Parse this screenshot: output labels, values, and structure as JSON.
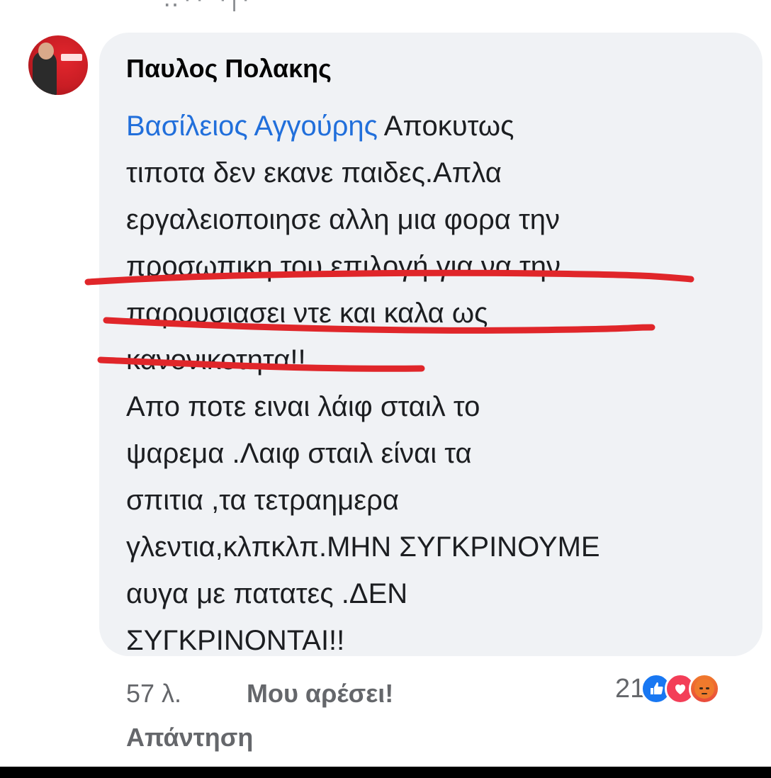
{
  "comment": {
    "author": "Παυλος Πολακης",
    "mention": "Βασίλειος Αγγούρης",
    "text_lines": [
      " Αποκυτως",
      "τιποτα δεν εκανε παιδες.Απλα",
      "εργαλειοποιησε αλλη μια φορα την",
      "προσωπικη του επιλογή για να την",
      "παρουσιασει ντε και καλα ως",
      "κανονικοτητα!!",
      "Απο ποτε ειναι λάιφ σταιλ το",
      "ψαρεμα .Λαιφ σταιλ είναι τα",
      "σπιτια ,τα τετραημερα",
      "γλεντια,κλπκλπ.ΜΗΝ ΣΥΓΚΡΙΝΟΥΜΕ",
      "αυγα με πατατες .ΔΕΝ",
      "ΣΥΓΚΡΙΝΟΝΤΑΙ!!"
    ]
  },
  "meta": {
    "time": "57 λ.",
    "like_label": "Μου αρέσει!",
    "reply_label": "Απάντηση",
    "reaction_count": "21"
  },
  "reactions": [
    "like-icon",
    "love-icon",
    "angry-icon"
  ],
  "colors": {
    "mention": "#216fdb",
    "bubble": "#f0f2f5",
    "underline": "#e0262a",
    "like": "#1877f2",
    "love": "#f33e58",
    "angry": "#f07a2c"
  }
}
